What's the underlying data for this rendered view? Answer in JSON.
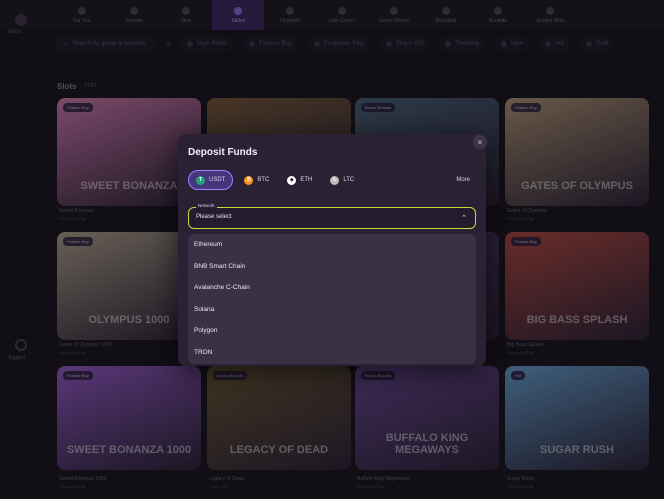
{
  "nav": {
    "items": [
      {
        "label": "For You"
      },
      {
        "label": "Recent"
      },
      {
        "label": "Slots"
      },
      {
        "label": "Tables"
      },
      {
        "label": "Originals"
      },
      {
        "label": "Live Casino"
      },
      {
        "label": "Game Shows"
      },
      {
        "label": "Blackjack"
      },
      {
        "label": "Roulette"
      },
      {
        "label": "Jackpot Slots"
      }
    ]
  },
  "rail": {
    "menu_label": "Menu",
    "support_label": "Support"
  },
  "filter": {
    "search_placeholder": "Search by game or provider",
    "chips": [
      "High Roller",
      "Feature Buy",
      "Pragmatic Play",
      "Play'n GO",
      "Trending",
      "New",
      "Hot",
      "Cold"
    ]
  },
  "section": {
    "title": "Slots",
    "count": "2981"
  },
  "cards": [
    {
      "title": "SWEET BONANZA",
      "name": "Sweet Bonanza",
      "provider": "Pragmatic Play",
      "badge": "Feature Buy",
      "bg": "#d980b6"
    },
    {
      "title": "",
      "name": "",
      "provider": "",
      "badge": "",
      "bg": "#7a5c3a"
    },
    {
      "title": "",
      "name": "",
      "provider": "",
      "badge": "Bonus Rounds",
      "bg": "#4b6478"
    },
    {
      "title": "GATES OF OLYMPUS",
      "name": "Gates of Olympus",
      "provider": "Pragmatic Play",
      "badge": "Feature Buy",
      "bg": "#b49a78"
    },
    {
      "title": "OLYMPUS 1000",
      "name": "Gates of Olympus 1000",
      "provider": "Pragmatic Play",
      "badge": "Feature Buy",
      "bg": "#b4a892"
    },
    {
      "title": "",
      "name": "",
      "provider": "",
      "badge": "",
      "bg": "#6a4f85"
    },
    {
      "title": "",
      "name": "",
      "provider": "",
      "badge": "",
      "bg": "#4f3a6a"
    },
    {
      "title": "BIG BASS SPLASH",
      "name": "Big Bass Splash",
      "provider": "Pragmatic Play",
      "badge": "Feature Buy",
      "bg": "#b84a42"
    },
    {
      "title": "SWEET BONANZA 1000",
      "name": "Sweet Bonanza 1000",
      "provider": "Pragmatic Play",
      "badge": "Feature Buy",
      "bg": "#9a5ed0"
    },
    {
      "title": "LEGACY OF DEAD",
      "name": "Legacy of Dead",
      "provider": "Play'n GO",
      "badge": "Bonus Rounds",
      "bg": "#6f5a36"
    },
    {
      "title": "BUFFALO KING MEGAWAYS",
      "name": "Buffalo King Megaways",
      "provider": "Pragmatic Play",
      "badge": "Bonus Rounds",
      "bg": "#6d4a9a"
    },
    {
      "title": "SUGAR RUSH",
      "name": "Sugar Rush",
      "provider": "Pragmatic Play",
      "badge": "Hot",
      "bg": "#6aa6d8"
    }
  ],
  "modal": {
    "title": "Deposit Funds",
    "close": "×",
    "tabs": [
      {
        "label": "USDT",
        "symbol": "T",
        "color": "#26a17b"
      },
      {
        "label": "BTC",
        "symbol": "₿",
        "color": "#f7931a"
      },
      {
        "label": "ETH",
        "symbol": "◆",
        "color": "#ffffff"
      },
      {
        "label": "LTC",
        "symbol": "Ł",
        "color": "#bfbbbb"
      }
    ],
    "more": "More",
    "network_label": "Network",
    "network_value": "Please select",
    "options": [
      "Ethereum",
      "BNB Smart Chain",
      "Avalanche C-Chain",
      "Solana",
      "Polygon",
      "TRON"
    ]
  }
}
